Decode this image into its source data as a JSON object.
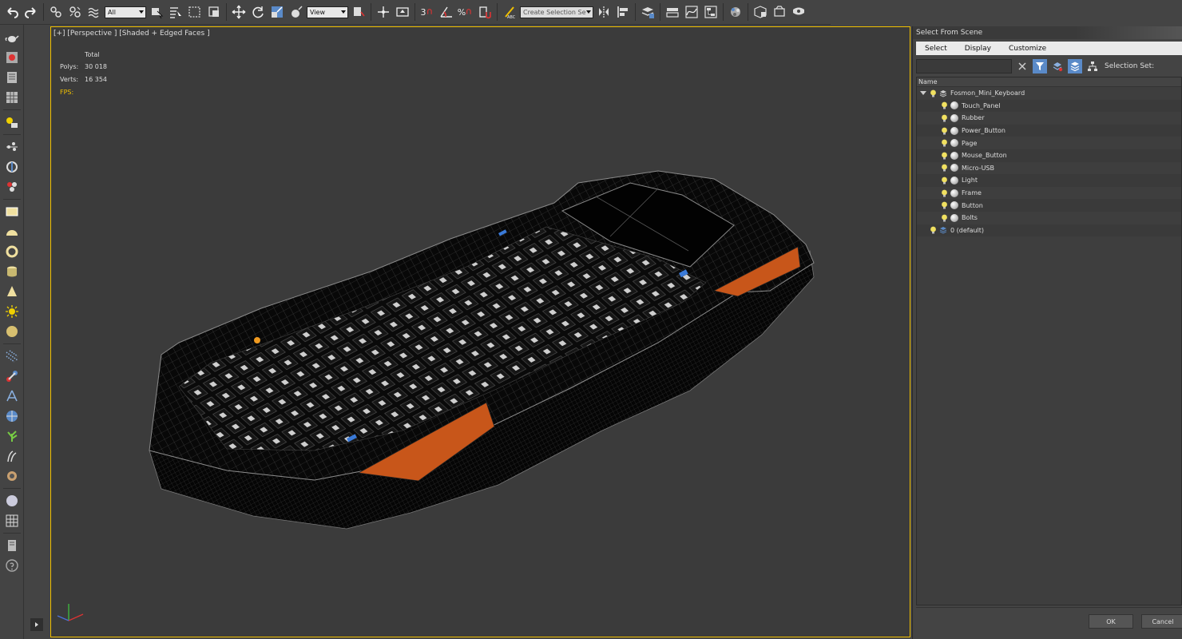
{
  "toolbar": {
    "filter_select": "All",
    "reference_select": "View",
    "snap_label": "3",
    "angle_label": "",
    "percent_label": "%",
    "selection_set_placeholder": "Create Selection Se"
  },
  "viewport": {
    "label": "[+] [Perspective ] [Shaded + Edged Faces ]",
    "stats": {
      "total_label": "Total",
      "polys_label": "Polys:",
      "polys_value": "30 018",
      "verts_label": "Verts:",
      "verts_value": "16 354",
      "fps_label": "FPS:"
    }
  },
  "scene_explorer": {
    "title": "Select From Scene",
    "menu": [
      "Select",
      "Display",
      "Customize"
    ],
    "selection_set_label": "Selection Set:",
    "column_name": "Name",
    "root": "Fosmon_Mini_Keyboard",
    "children": [
      "Touch_Panel",
      "Rubber",
      "Power_Button",
      "Page",
      "Mouse_Button",
      "Micro-USB",
      "Light",
      "Frame",
      "Button",
      "Bolts"
    ],
    "default_layer": "0 (default)",
    "ok_label": "OK",
    "cancel_label": "Cancel"
  },
  "colors": {
    "accent_yellow": "#f0c000",
    "highlight_blue": "#5a8ac8",
    "orange_rubber": "#c8561a"
  }
}
